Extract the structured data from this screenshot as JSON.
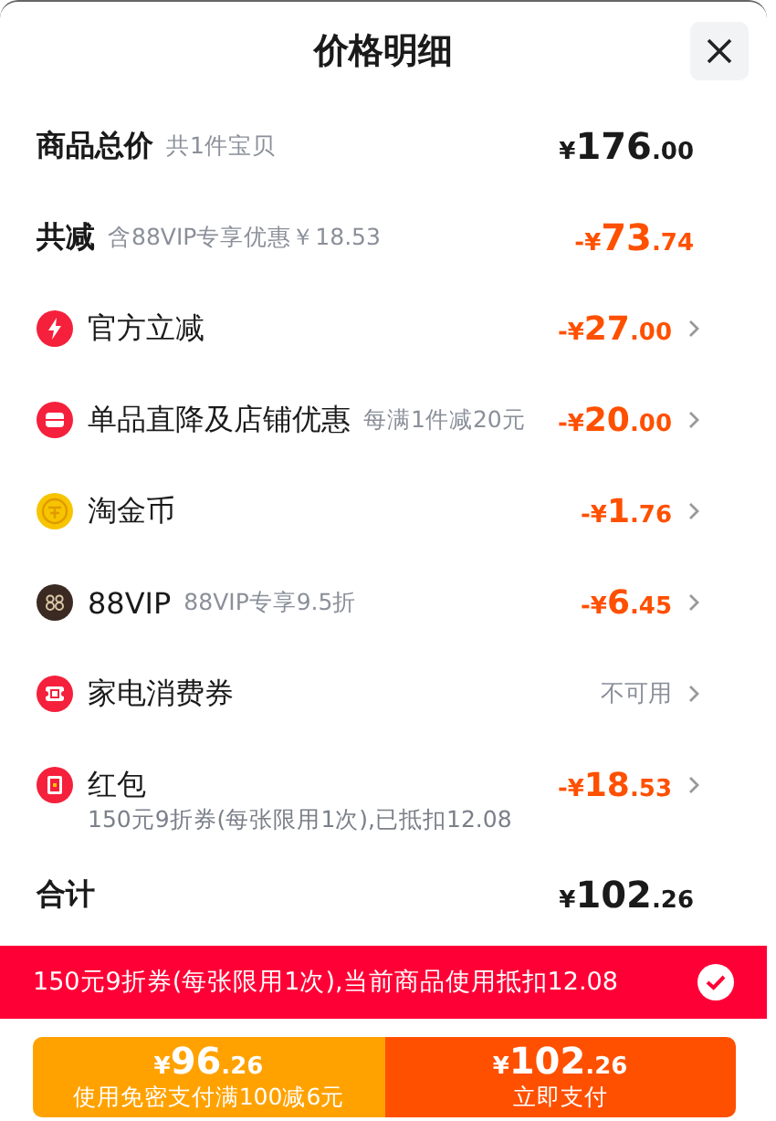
{
  "title": "价格明细",
  "summary": [
    {
      "label": "商品总价",
      "note": "共1件宝贝",
      "amount": "¥176.00",
      "discount": false
    },
    {
      "label": "共减",
      "note": "含88VIP专享优惠￥18.53",
      "amount": "-¥73.74",
      "discount": true
    }
  ],
  "items": [
    {
      "kind": "bolt",
      "label": "官方立减",
      "amount": "-¥27.00",
      "disabled": false
    },
    {
      "kind": "shop",
      "label": "单品直降及店铺优惠",
      "note": "每满1件减20元",
      "amount": "-¥20.00",
      "disabled": false
    },
    {
      "kind": "coin",
      "label": "淘金币",
      "amount": "-¥1.76",
      "disabled": false
    },
    {
      "kind": "vip",
      "label": "88VIP",
      "note": "88VIP专享9.5折",
      "amount": "-¥6.45",
      "disabled": false
    },
    {
      "kind": "ticket",
      "label": "家电消费券",
      "amount": "不可用",
      "disabled": true
    },
    {
      "kind": "packet",
      "label": "红包",
      "amount": "-¥18.53",
      "detail": "150元9折券(每张限用1次),已抵扣12.08",
      "disabled": false
    }
  ],
  "total": {
    "label": "合计",
    "amount": "¥102.26"
  },
  "banner": {
    "text": "150元9折券(每张限用1次),当前商品使用抵扣12.08",
    "checked": true
  },
  "buttons": [
    {
      "kind": "secondary",
      "amount": "¥96.26",
      "caption": "使用免密支付满100减6元"
    },
    {
      "kind": "primary",
      "amount": "¥102.26",
      "caption": "立即支付"
    }
  ]
}
